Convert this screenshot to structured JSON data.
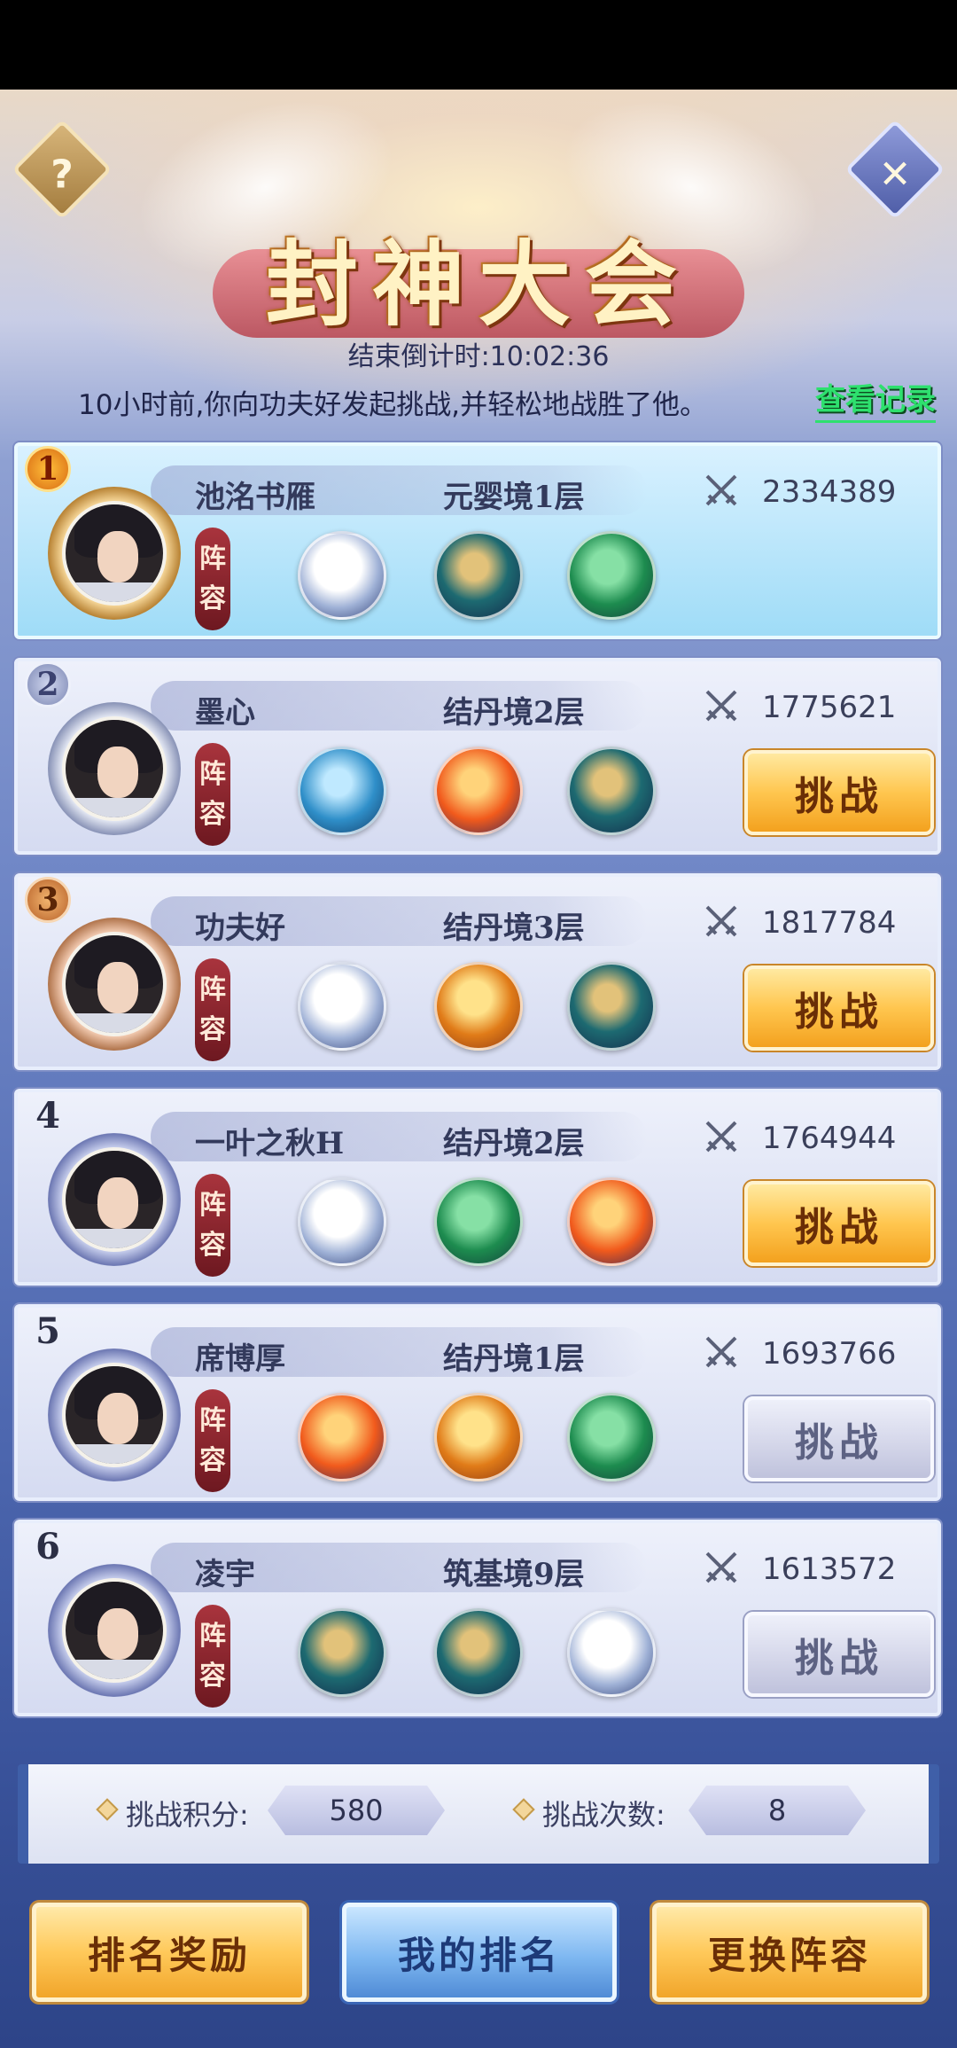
{
  "header": {
    "title": "封神大会",
    "help_glyph": "?",
    "close_glyph": "✕",
    "countdown": "结束倒计时:10:02:36",
    "notice": "10小时前,你向功夫好发起挑战,并轻松地战胜了他。",
    "record_link": "查看记录"
  },
  "rows": [
    {
      "rank": "1",
      "name": "池洺书雁",
      "realm": "元婴境1层",
      "power": "2334389",
      "lineup_label_1": "阵",
      "lineup_label_2": "容",
      "beasts": [
        "tiger",
        "dragon-teal",
        "dragon-green"
      ],
      "button": ""
    },
    {
      "rank": "2",
      "name": "墨心",
      "realm": "结丹境2层",
      "power": "1775621",
      "lineup_label_1": "阵",
      "lineup_label_2": "容",
      "beasts": [
        "whale",
        "phoenix",
        "dragon-teal"
      ],
      "button": "挑战",
      "button_state": "active"
    },
    {
      "rank": "3",
      "name": "功夫好",
      "realm": "结丹境3层",
      "power": "1817784",
      "lineup_label_1": "阵",
      "lineup_label_2": "容",
      "beasts": [
        "tiger",
        "dragon-gold",
        "dragon-teal"
      ],
      "button": "挑战",
      "button_state": "active"
    },
    {
      "rank": "4",
      "name": "一叶之秋H",
      "realm": "结丹境2层",
      "power": "1764944",
      "lineup_label_1": "阵",
      "lineup_label_2": "容",
      "beasts": [
        "tiger",
        "dragon-green",
        "phoenix"
      ],
      "button": "挑战",
      "button_state": "active"
    },
    {
      "rank": "5",
      "name": "席博厚",
      "realm": "结丹境1层",
      "power": "1693766",
      "lineup_label_1": "阵",
      "lineup_label_2": "容",
      "beasts": [
        "phoenix",
        "dragon-gold",
        "dragon-green"
      ],
      "button": "挑战",
      "button_state": "disabled"
    },
    {
      "rank": "6",
      "name": "凌宇",
      "realm": "筑基境9层",
      "power": "1613572",
      "lineup_label_1": "阵",
      "lineup_label_2": "容",
      "beasts": [
        "dragon-teal",
        "dragon-teal",
        "tiger"
      ],
      "button": "挑战",
      "button_state": "disabled"
    }
  ],
  "score": {
    "points_label": "挑战积分:",
    "points_value": "580",
    "attempts_label": "挑战次数:",
    "attempts_value": "8"
  },
  "bottom": {
    "rank_rewards": "排名奖励",
    "my_rank": "我的排名",
    "change_lineup": "更换阵容"
  },
  "colors": {
    "accent_gold": "#ffc64f",
    "link_green": "#2ee06e",
    "lineup_red": "#a9343d"
  }
}
